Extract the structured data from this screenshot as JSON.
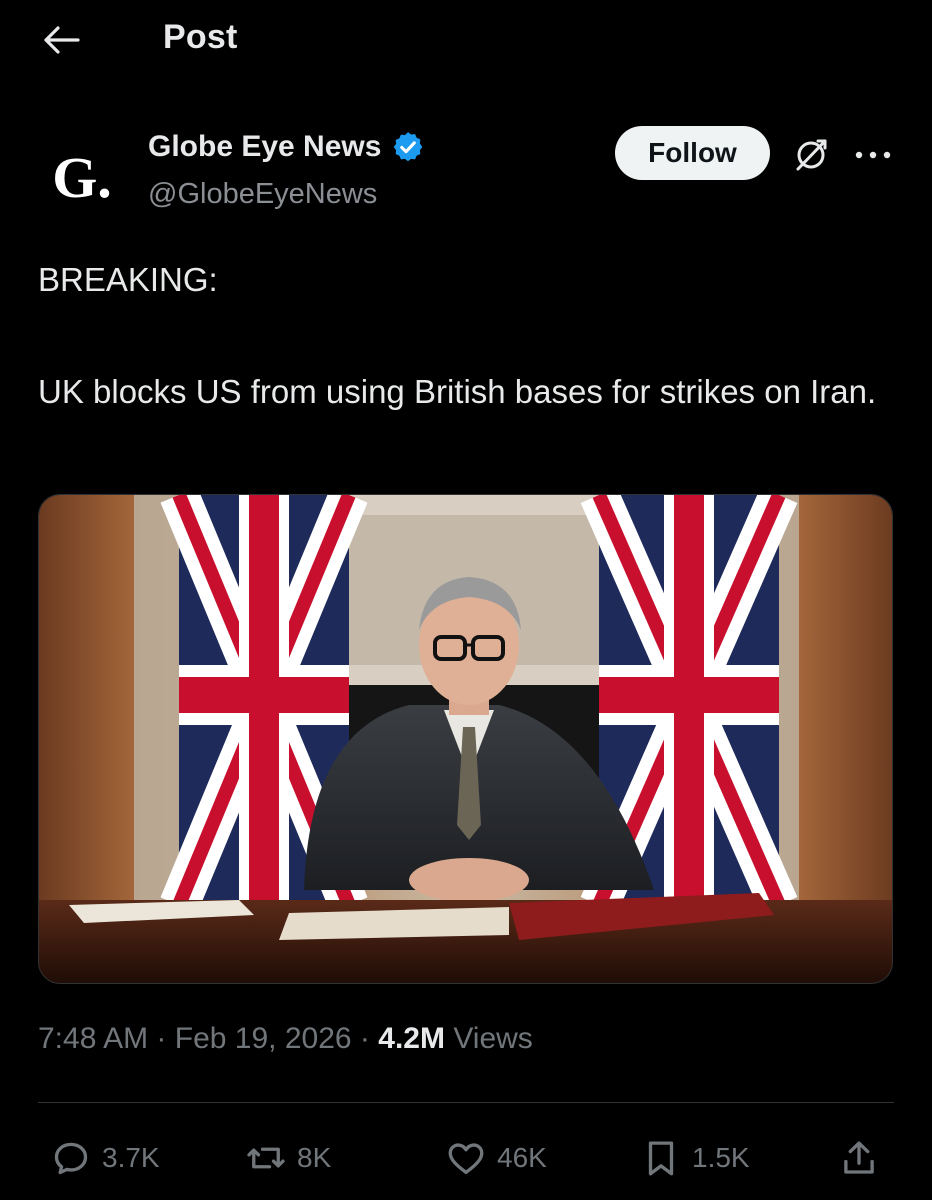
{
  "header": {
    "title": "Post"
  },
  "author": {
    "avatar_letter": "G.",
    "display_name": "Globe Eye News",
    "handle": "@GlobeEyeNews",
    "follow_label": "Follow"
  },
  "post": {
    "lines": [
      "BREAKING:",
      "UK blocks US from using British bases for strikes on Iran."
    ],
    "time": "7:48 AM",
    "date": "Feb 19, 2026",
    "separator": "·",
    "views_count": "4.2M",
    "views_label": "Views"
  },
  "actions": {
    "replies": "3.7K",
    "reposts": "8K",
    "likes": "46K",
    "bookmarks": "1.5K"
  },
  "colors": {
    "background": "#000000",
    "text_primary": "#e7e9ea",
    "text_secondary": "#71767b",
    "verified_badge": "#1d9bf0",
    "follow_button": "#eff3f4"
  },
  "icons": [
    "back-arrow-icon",
    "verified-badge-icon",
    "grok-icon",
    "more-icon",
    "reply-icon",
    "repost-icon",
    "like-icon",
    "bookmark-icon",
    "share-icon"
  ]
}
